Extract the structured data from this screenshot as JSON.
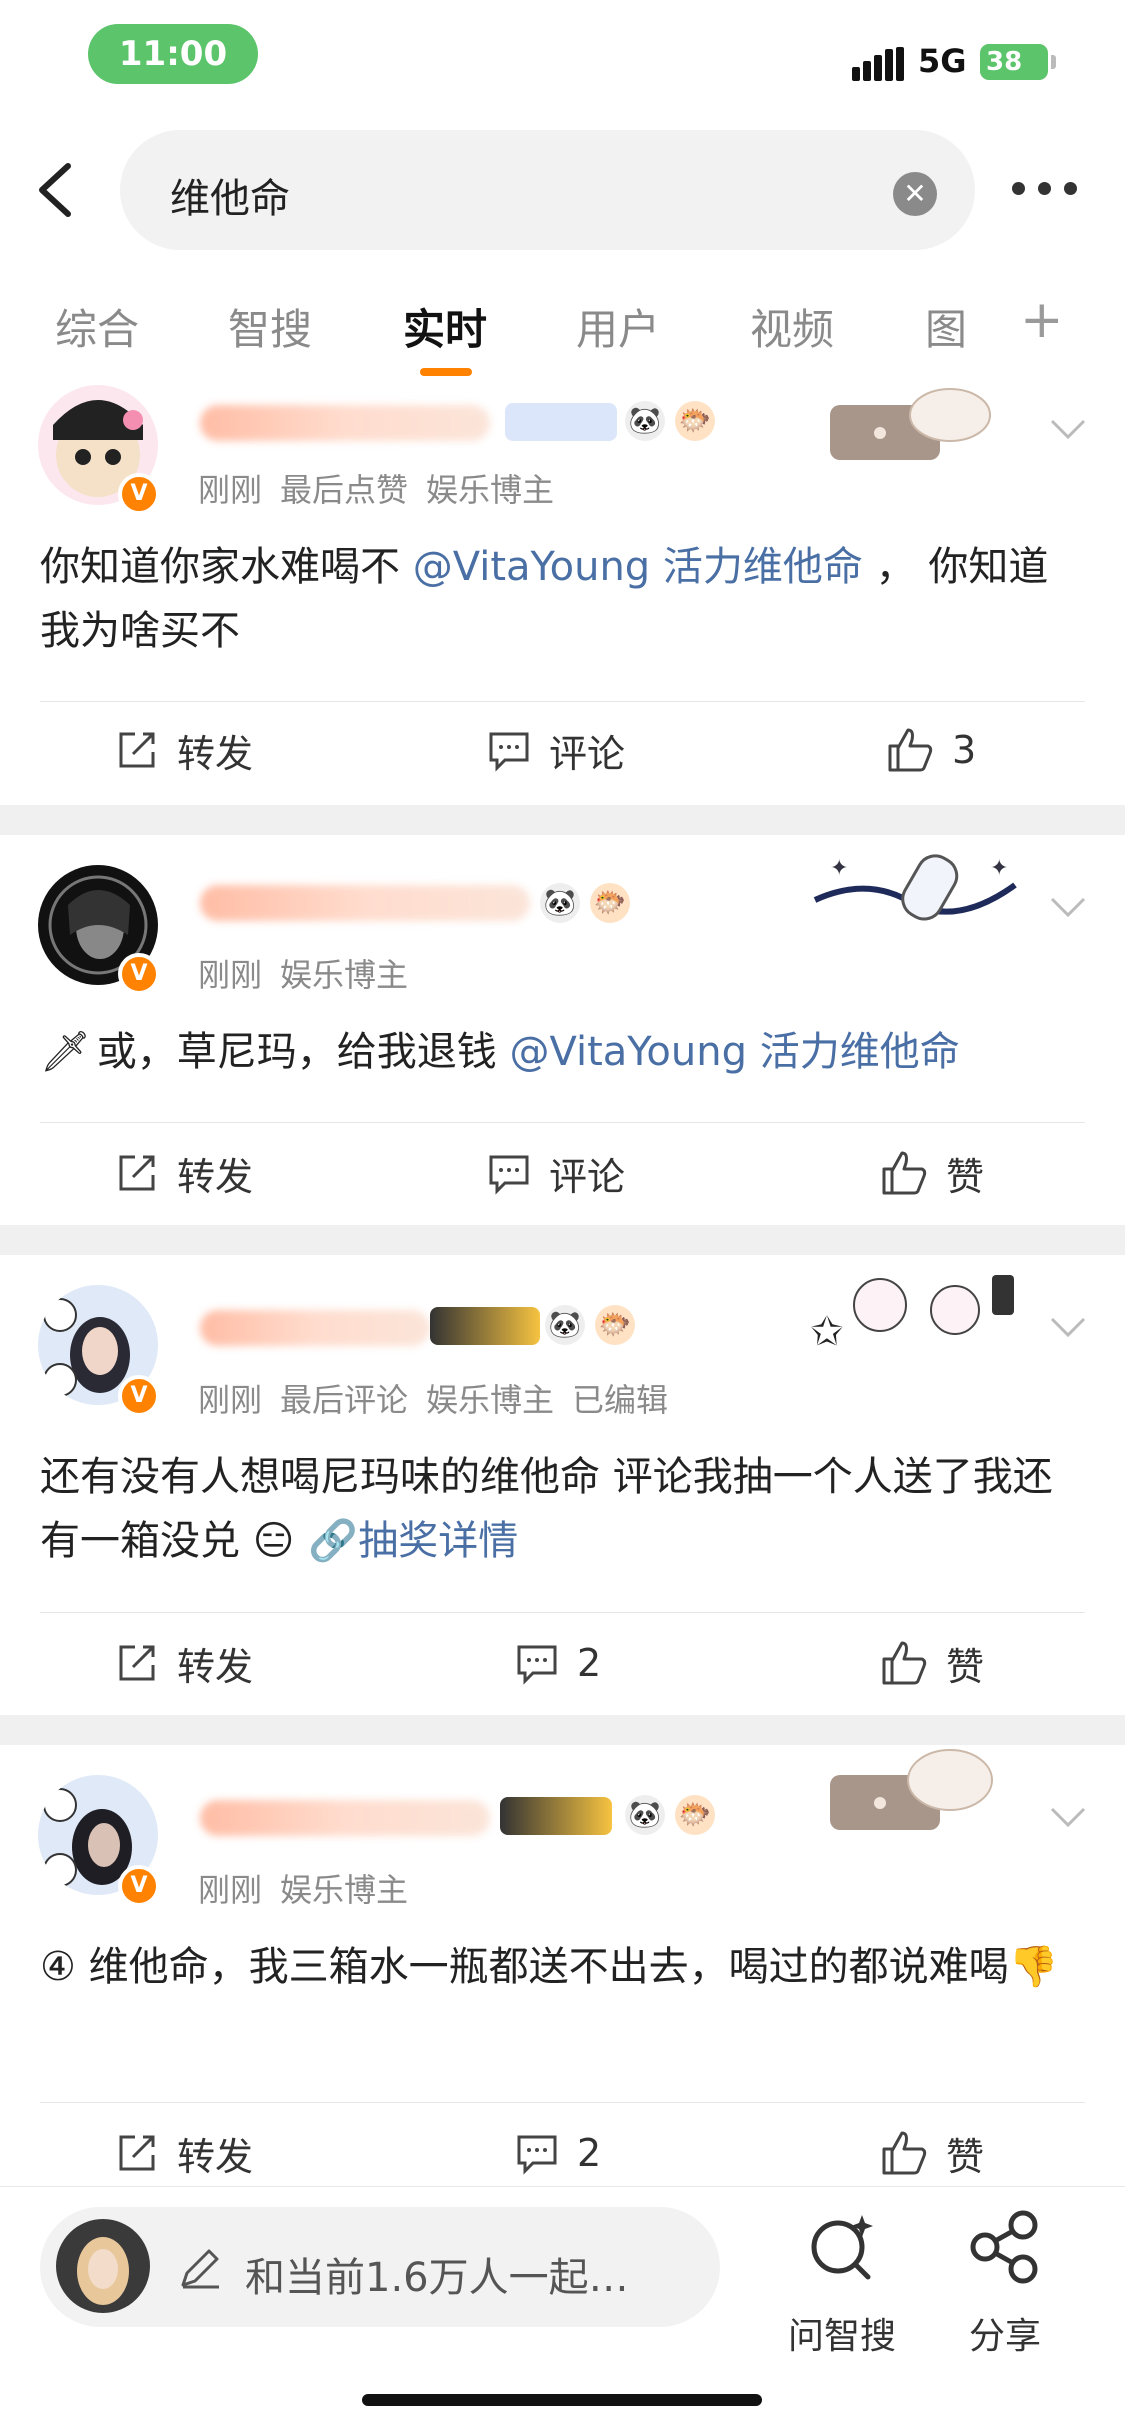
{
  "status_bar": {
    "time": "11:00",
    "network": "5G",
    "battery": "38"
  },
  "search": {
    "query": "维他命"
  },
  "tabs": [
    "综合",
    "智搜",
    "实时",
    "用户",
    "视频",
    "图"
  ],
  "posts": [
    {
      "meta": [
        "刚刚",
        "最后点赞",
        "娱乐博主"
      ],
      "content_prefix": "你知道你家水难喝不 ",
      "mention": "@VitaYoung 活力维他命",
      "content_suffix": " ， 你知道我为啥买不",
      "repost": "转发",
      "comment": "评论",
      "like": "3"
    },
    {
      "meta": [
        "刚刚",
        "娱乐博主"
      ],
      "content_prefix": "或，草尼玛，给我退钱 ",
      "mention": "@VitaYoung 活力维他命",
      "content_suffix": "",
      "repost": "转发",
      "comment": "评论",
      "like": "赞"
    },
    {
      "meta": [
        "刚刚",
        "最后评论",
        "娱乐博主",
        "已编辑"
      ],
      "content_prefix": "还有没有人想喝尼玛味的维他命 评论我抽一个人送了我还有一箱没兑 ",
      "mention": "抽奖详情",
      "content_suffix": "",
      "repost": "转发",
      "comment": "2",
      "like": "赞"
    },
    {
      "meta": [
        "刚刚",
        "娱乐博主"
      ],
      "content_prefix": "④ 维他命，我三箱水一瓶都送不出去，喝过的都说难喝",
      "mention": "",
      "content_suffix": "",
      "repost": "转发",
      "comment": "2",
      "like": "赞"
    }
  ],
  "bottom_bar": {
    "compose_placeholder": "和当前1.6万人一起…",
    "smart_search": "问智搜",
    "share": "分享"
  },
  "colors": {
    "accent": "#ff8200",
    "mention": "#4a6fa5",
    "pill": "#5cc46a"
  }
}
